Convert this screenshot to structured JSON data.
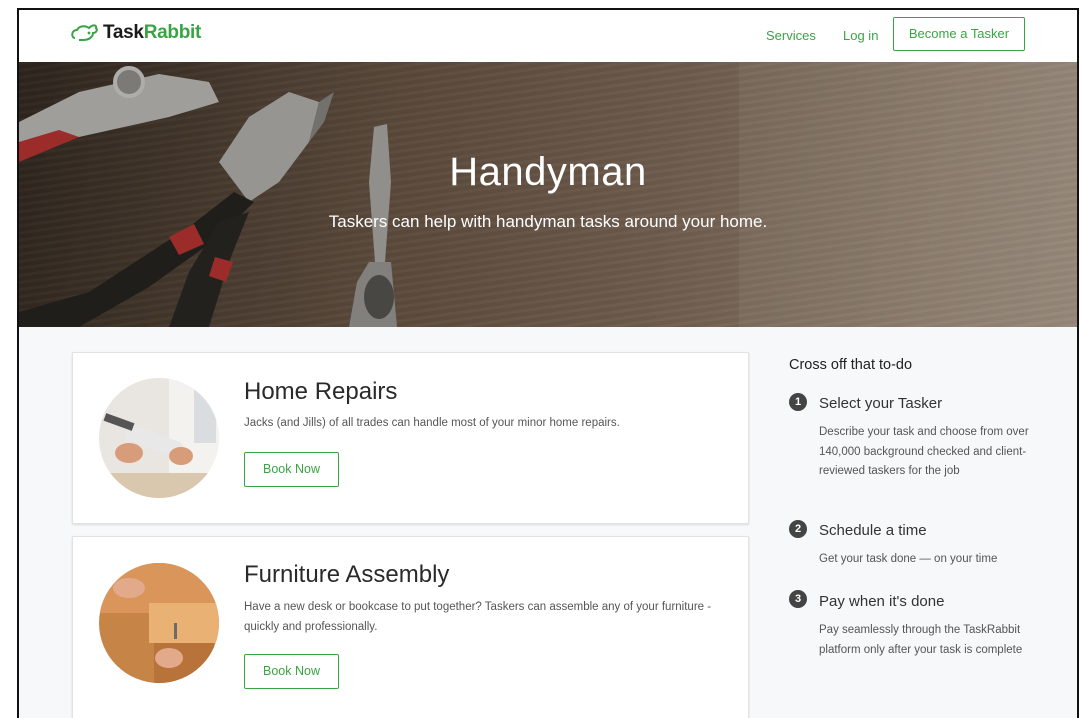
{
  "header": {
    "logo_text_dark": "Task",
    "logo_text_green": "Rabbit",
    "nav": {
      "services": "Services",
      "login": "Log in",
      "become_tasker": "Become a Tasker"
    }
  },
  "hero": {
    "title": "Handyman",
    "subtitle": "Taskers can help with handyman tasks around your home."
  },
  "services": [
    {
      "title": "Home Repairs",
      "description": "Jacks (and Jills) of all trades can handle most of your minor home repairs.",
      "button": "Book Now"
    },
    {
      "title": "Furniture Assembly",
      "description": "Have a new desk or bookcase to put together? Taskers can assemble any of your furniture - quickly and professionally.",
      "button": "Book Now"
    }
  ],
  "sidebar": {
    "heading": "Cross off that to-do",
    "steps": [
      {
        "number": "1",
        "title": "Select your Tasker",
        "description": "Describe your task and choose from over 140,000 background checked and client-reviewed taskers for the job"
      },
      {
        "number": "2",
        "title": "Schedule a time",
        "description": "Get your task done — on your time"
      },
      {
        "number": "3",
        "title": "Pay when it's done",
        "description": "Pay seamlessly through the TaskRabbit platform only after your task is complete"
      }
    ]
  },
  "colors": {
    "brand_green": "#3aa444",
    "text_dark": "#2a2a2a",
    "page_bg": "#f7f8fa"
  }
}
